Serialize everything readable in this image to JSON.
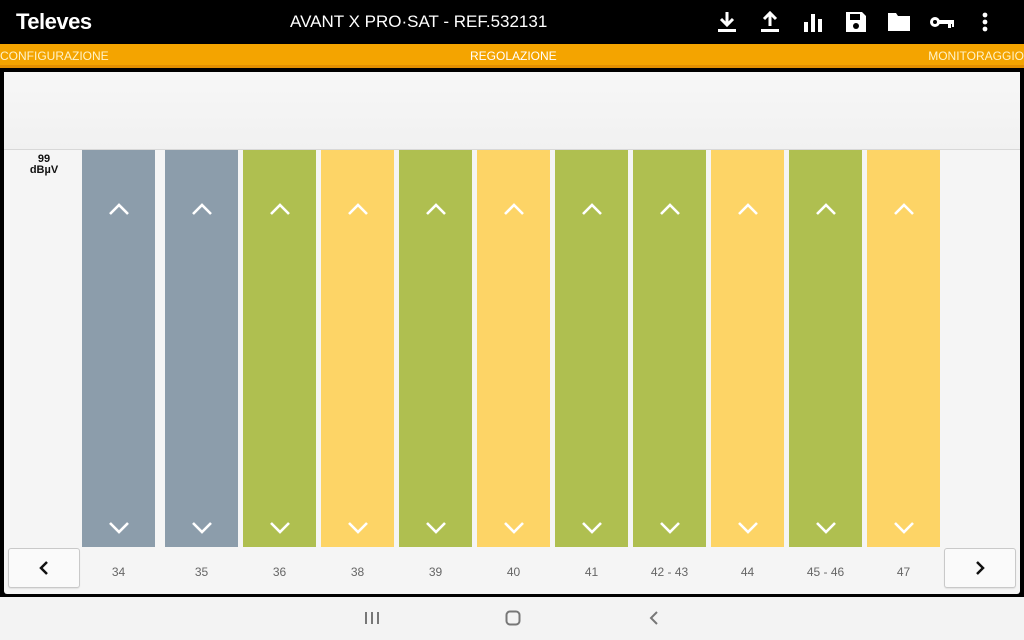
{
  "app": {
    "logo": "Televes",
    "device_title": "AVANT X  PRO·SAT - REF.532131"
  },
  "toolbar": {
    "icons": [
      "download-icon",
      "upload-icon",
      "bar-chart-icon",
      "save-icon",
      "folder-icon",
      "key-icon",
      "more-vert-icon"
    ]
  },
  "tabs": [
    {
      "label": "CONFIGURAZIONE",
      "active": false
    },
    {
      "label": "REGOLAZIONE",
      "active": true
    },
    {
      "label": "MONITORAGGIO",
      "active": false
    }
  ],
  "level": {
    "value": "99",
    "unit": "dBµV"
  },
  "colors": {
    "grey": "#8c9dab",
    "green": "#afbf50",
    "yellow": "#fdd466",
    "accent": "#f4a400"
  },
  "channels": [
    {
      "label": "34",
      "color": "grey"
    },
    {
      "label": "35",
      "color": "grey"
    },
    {
      "label": "36",
      "color": "green"
    },
    {
      "label": "38",
      "color": "yellow"
    },
    {
      "label": "39",
      "color": "green"
    },
    {
      "label": "40",
      "color": "yellow"
    },
    {
      "label": "41",
      "color": "green"
    },
    {
      "label": "42 - 43",
      "color": "green"
    },
    {
      "label": "44",
      "color": "yellow"
    },
    {
      "label": "45 - 46",
      "color": "green"
    },
    {
      "label": "47",
      "color": "yellow"
    }
  ],
  "navigation": {
    "prev_icon": "chevron-left-icon",
    "next_icon": "chevron-right-icon"
  },
  "system_nav": [
    "recent-apps-icon",
    "home-icon",
    "back-icon"
  ]
}
